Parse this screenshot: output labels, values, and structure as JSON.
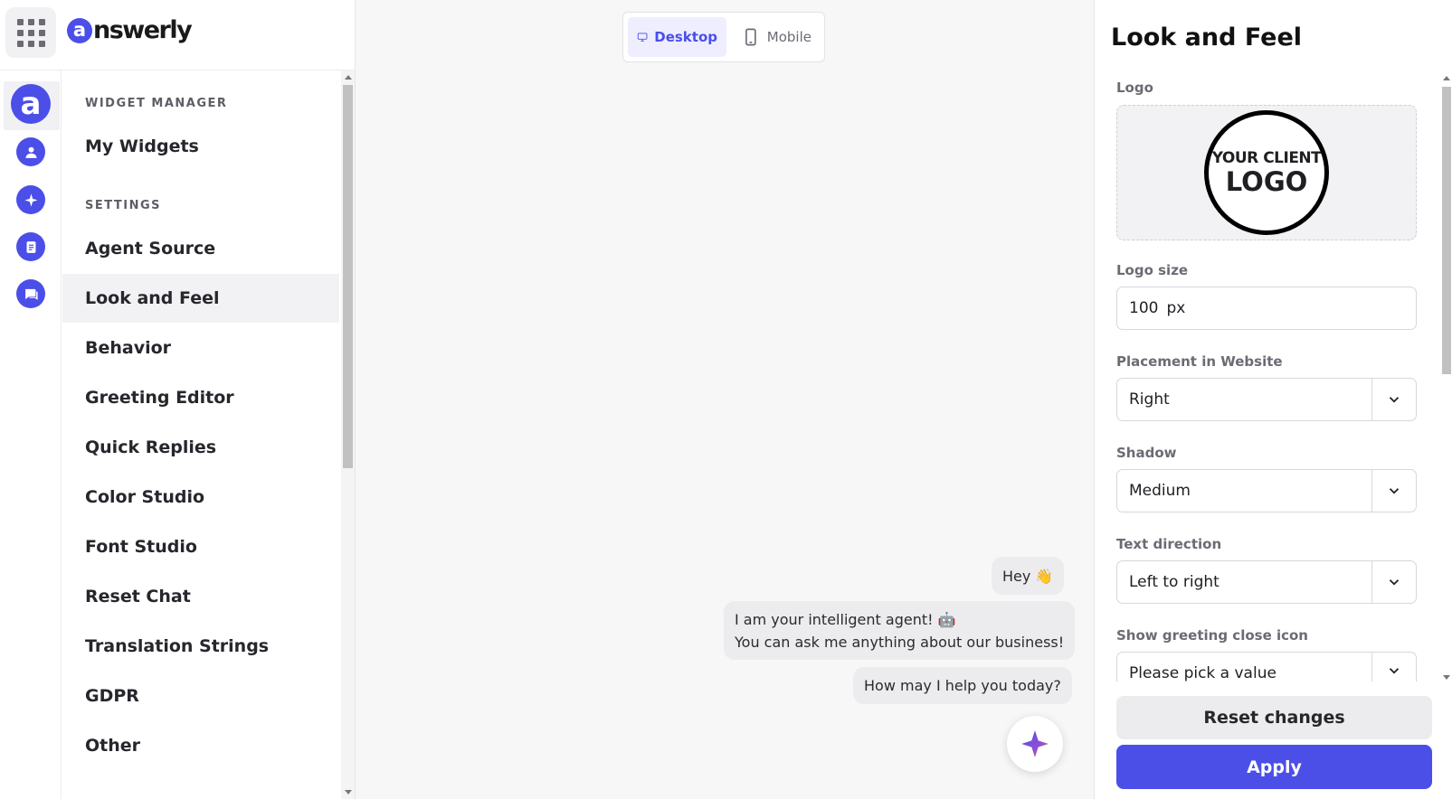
{
  "brand": {
    "mark": "a",
    "name": "nswerly",
    "rail_logo": "a"
  },
  "rail": [
    {
      "icon": "user-icon"
    },
    {
      "icon": "sparkle-icon"
    },
    {
      "icon": "document-icon"
    },
    {
      "icon": "chat-icon"
    }
  ],
  "nav": {
    "section_widget": "WIDGET MANAGER",
    "my_widgets": "My Widgets",
    "section_settings": "SETTINGS",
    "items": [
      {
        "label": "Agent Source"
      },
      {
        "label": "Look and Feel",
        "active": true
      },
      {
        "label": "Behavior"
      },
      {
        "label": "Greeting Editor"
      },
      {
        "label": "Quick Replies"
      },
      {
        "label": "Color Studio"
      },
      {
        "label": "Font Studio"
      },
      {
        "label": "Reset Chat"
      },
      {
        "label": "Translation Strings"
      },
      {
        "label": "GDPR"
      },
      {
        "label": "Other"
      }
    ]
  },
  "preview": {
    "toggle": {
      "desktop": "Desktop",
      "mobile": "Mobile",
      "selected": "Desktop"
    },
    "messages": [
      {
        "lines": [
          "Hey 👋"
        ]
      },
      {
        "lines": [
          "I am your intelligent agent! 🤖",
          "You can ask me anything about our business!"
        ]
      },
      {
        "lines": [
          "How may I help you today?"
        ]
      }
    ]
  },
  "panel": {
    "title": "Look and Feel",
    "logo_label": "Logo",
    "client_logo": {
      "line1": "YOUR CLIENT",
      "line2": "LOGO"
    },
    "logo_size_label": "Logo size",
    "logo_size_value": "100",
    "logo_size_unit": "px",
    "placement_label": "Placement in Website",
    "placement_value": "Right",
    "shadow_label": "Shadow",
    "shadow_value": "Medium",
    "text_direction_label": "Text direction",
    "text_direction_value": "Left to right",
    "greeting_close_label": "Show greeting close icon",
    "greeting_close_value": "Please pick a value",
    "reset_label": "Reset changes",
    "apply_label": "Apply"
  },
  "colors": {
    "accent": "#4b4fe8",
    "surface": "#ffffff",
    "canvas": "#f7f7f7"
  }
}
